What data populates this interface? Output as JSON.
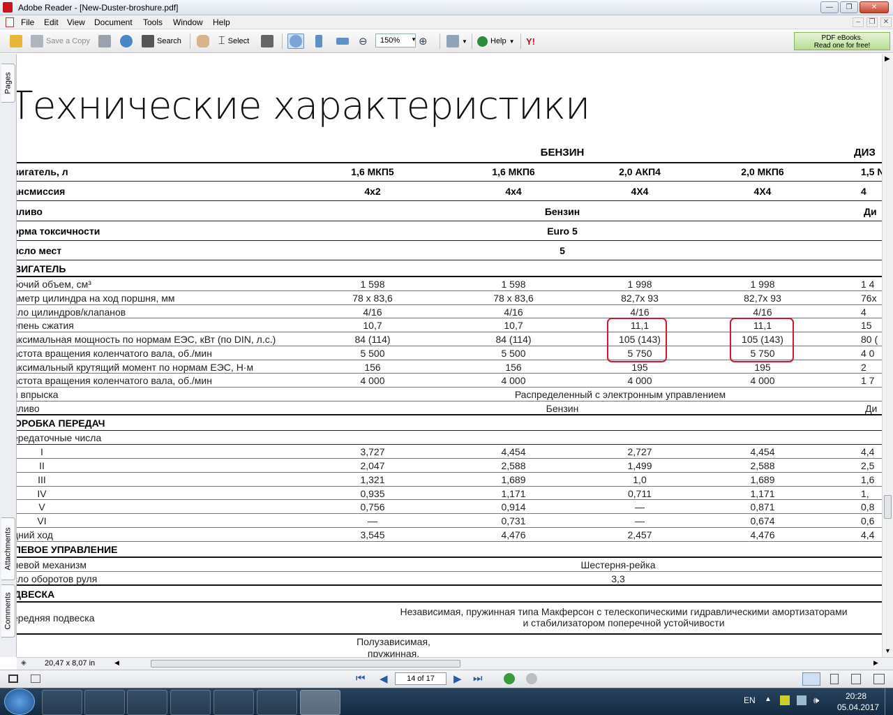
{
  "window": {
    "title": "Adobe Reader - [New-Duster-broshure.pdf]"
  },
  "menu": [
    "File",
    "Edit",
    "View",
    "Document",
    "Tools",
    "Window",
    "Help"
  ],
  "toolbar": {
    "save_copy": "Save a Copy",
    "search": "Search",
    "select": "Select",
    "zoom": "150%",
    "help": "Help",
    "yahoo": "Y!"
  },
  "ebook": {
    "line1": "PDF eBooks.",
    "line2": "Read one for free!"
  },
  "side_tabs": {
    "pages": "Pages",
    "attachments": "Attachments",
    "comments": "Comments"
  },
  "status": {
    "page_size": "20,47 x 8,07 in",
    "page_indicator": "14 of 17"
  },
  "tray": {
    "lang": "EN",
    "time": "20:28",
    "date": "05.04.2017"
  },
  "doc": {
    "title": "Технические характеристики",
    "group_benzin": "БЕНЗИН",
    "group_diesel": "ДИЗ",
    "columns": {
      "engine": [
        "1,6 МКП5",
        "1,6 МКП6",
        "2,0 АКП4",
        "2,0  МКП6",
        "1,5 N"
      ],
      "transmission": [
        "4х2",
        "4х4",
        "4Х4",
        "4Х4",
        "4"
      ]
    },
    "labels": {
      "engine": "вигатель, л",
      "transmission": "ансмиссия",
      "fuel": "пливо",
      "toxicity": "орма токсичности",
      "seats": "исло мест"
    },
    "fuel_benzin": "Бензин",
    "fuel_diesel": "Ди",
    "toxicity": "Euro 5",
    "seats": "5",
    "sec_engine": "ВИГАТЕЛЬ",
    "engine_rows": [
      {
        "label": "бочий объем, см³",
        "v": [
          "1 598",
          "1 598",
          "1 998",
          "1 998",
          "1 4"
        ]
      },
      {
        "label": "аметр цилиндра на ход поршня, мм",
        "v": [
          "78 x 83,6",
          "78 x 83,6",
          "82,7x 93",
          "82,7x 93",
          "76x"
        ]
      },
      {
        "label": "сло цилиндров/клапанов",
        "v": [
          "4/16",
          "4/16",
          "4/16",
          "4/16",
          "4"
        ]
      },
      {
        "label": "епень сжатия",
        "v": [
          "10,7",
          "10,7",
          "11,1",
          "11,1",
          "15"
        ]
      },
      {
        "label": "аксимальная мощность по нормам ЕЭС, кВт (по DIN, л.с.)",
        "v": [
          "84 (114)",
          "84 (114)",
          "105 (143)",
          "105 (143)",
          "80 ("
        ]
      },
      {
        "label": "астота вращения коленчатого вала, об./мин",
        "v": [
          "5 500",
          "5 500",
          "5 750",
          "5 750",
          "4 0"
        ]
      },
      {
        "label": "аксимальный крутящий момент по нормам ЕЭС, Н·м",
        "v": [
          "156",
          "156",
          "195",
          "195",
          "2"
        ]
      },
      {
        "label": "астота вращения коленчатого вала, об./мин",
        "v": [
          "4 000",
          "4 000",
          "4 000",
          "4 000",
          "1 7"
        ]
      }
    ],
    "injection_label": "п впрыска",
    "injection_value": "Распределенный с электронным управлением",
    "fuel2_label": "пливо",
    "fuel2_benzin": "Бензин",
    "fuel2_diesel": "Ди",
    "sec_gearbox": "ОРОБКА ПЕРЕДАЧ",
    "ratios_label": "ередаточные числа",
    "gear_rows": [
      {
        "label": "I",
        "v": [
          "3,727",
          "4,454",
          "2,727",
          "4,454",
          "4,4"
        ]
      },
      {
        "label": "II",
        "v": [
          "2,047",
          "2,588",
          "1,499",
          "2,588",
          "2,5"
        ]
      },
      {
        "label": "III",
        "v": [
          "1,321",
          "1,689",
          "1,0",
          "1,689",
          "1,6"
        ]
      },
      {
        "label": "IV",
        "v": [
          "0,935",
          "1,171",
          "0,711",
          "1,171",
          "1,"
        ]
      },
      {
        "label": "V",
        "v": [
          "0,756",
          "0,914",
          "—",
          "0,871",
          "0,8"
        ]
      },
      {
        "label": "VI",
        "v": [
          "—",
          "0,731",
          "—",
          "0,674",
          "0,6"
        ]
      },
      {
        "label": "дний ход",
        "v": [
          "3,545",
          "4,476",
          "2,457",
          "4,476",
          "4,4"
        ]
      }
    ],
    "sec_steering": "ЛЕВОЕ УПРАВЛЕНИЕ",
    "steer_label": "левой механизм",
    "steer_value": "Шестерня-рейка",
    "turns_label": "сло оборотов руля",
    "turns_value": "3,3",
    "sec_susp": "ДВЕСКА",
    "front_label": "ередняя подвеска",
    "front_value1": "Независимая, пружинная типа Макферсон с телескопическими гидравлическими амортизаторами",
    "front_value2": "и стабилизатором поперечной устойчивости",
    "rear_value1": "Полузависимая,",
    "rear_value2": "пружинная,"
  }
}
